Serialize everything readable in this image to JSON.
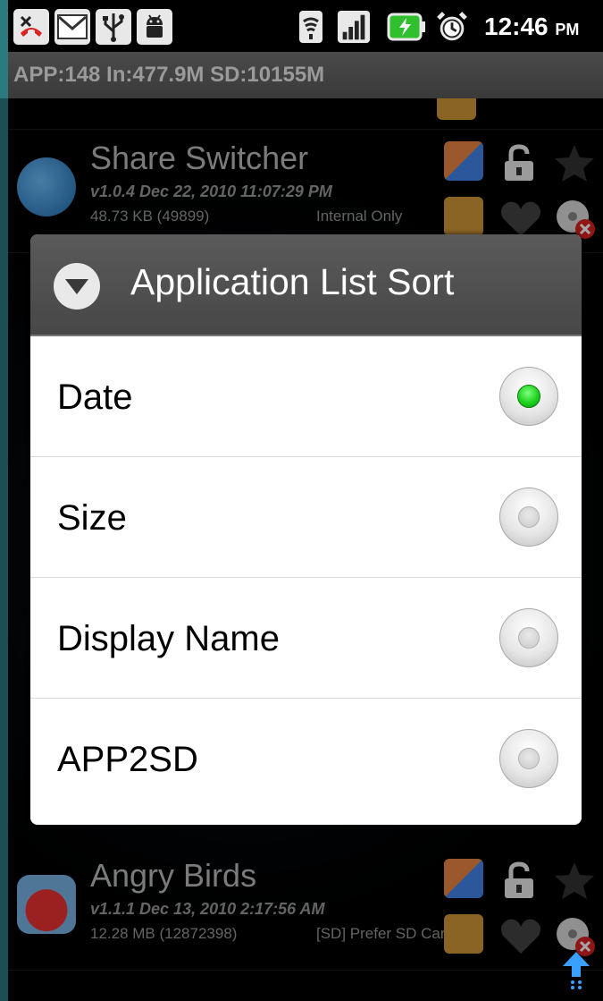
{
  "status_bar": {
    "time": "12:46",
    "ampm": "PM",
    "left_icons": [
      "missed-call-icon",
      "gmail-icon",
      "usb-icon",
      "android-debug-icon"
    ],
    "right_icons": [
      "wifi-icon",
      "signal-icon",
      "battery-charging-icon",
      "alarm-icon"
    ]
  },
  "header": {
    "summary": "APP:148 In:477.9M SD:10155M"
  },
  "apps": [
    {
      "name": "Share Switcher",
      "version": "v1.0.4 Dec 22, 2010 11:07:29 PM",
      "size": "48.73 KB (49899)",
      "location": "Internal Only"
    },
    {
      "name": "Angry Birds",
      "version": "v1.1.1 Dec 13, 2010 2:17:56 AM",
      "size": "12.28 MB (12872398)",
      "location": "[SD] Prefer SD Card"
    }
  ],
  "dialog": {
    "title": "Application List Sort",
    "options": [
      {
        "label": "Date",
        "selected": true
      },
      {
        "label": "Size",
        "selected": false
      },
      {
        "label": "Display Name",
        "selected": false
      },
      {
        "label": "APP2SD",
        "selected": false
      }
    ]
  },
  "colors": {
    "selected_radio": "#1fd21f",
    "dialog_title_bg": "#4f4f4f",
    "left_stripe": "#2a7a80"
  }
}
